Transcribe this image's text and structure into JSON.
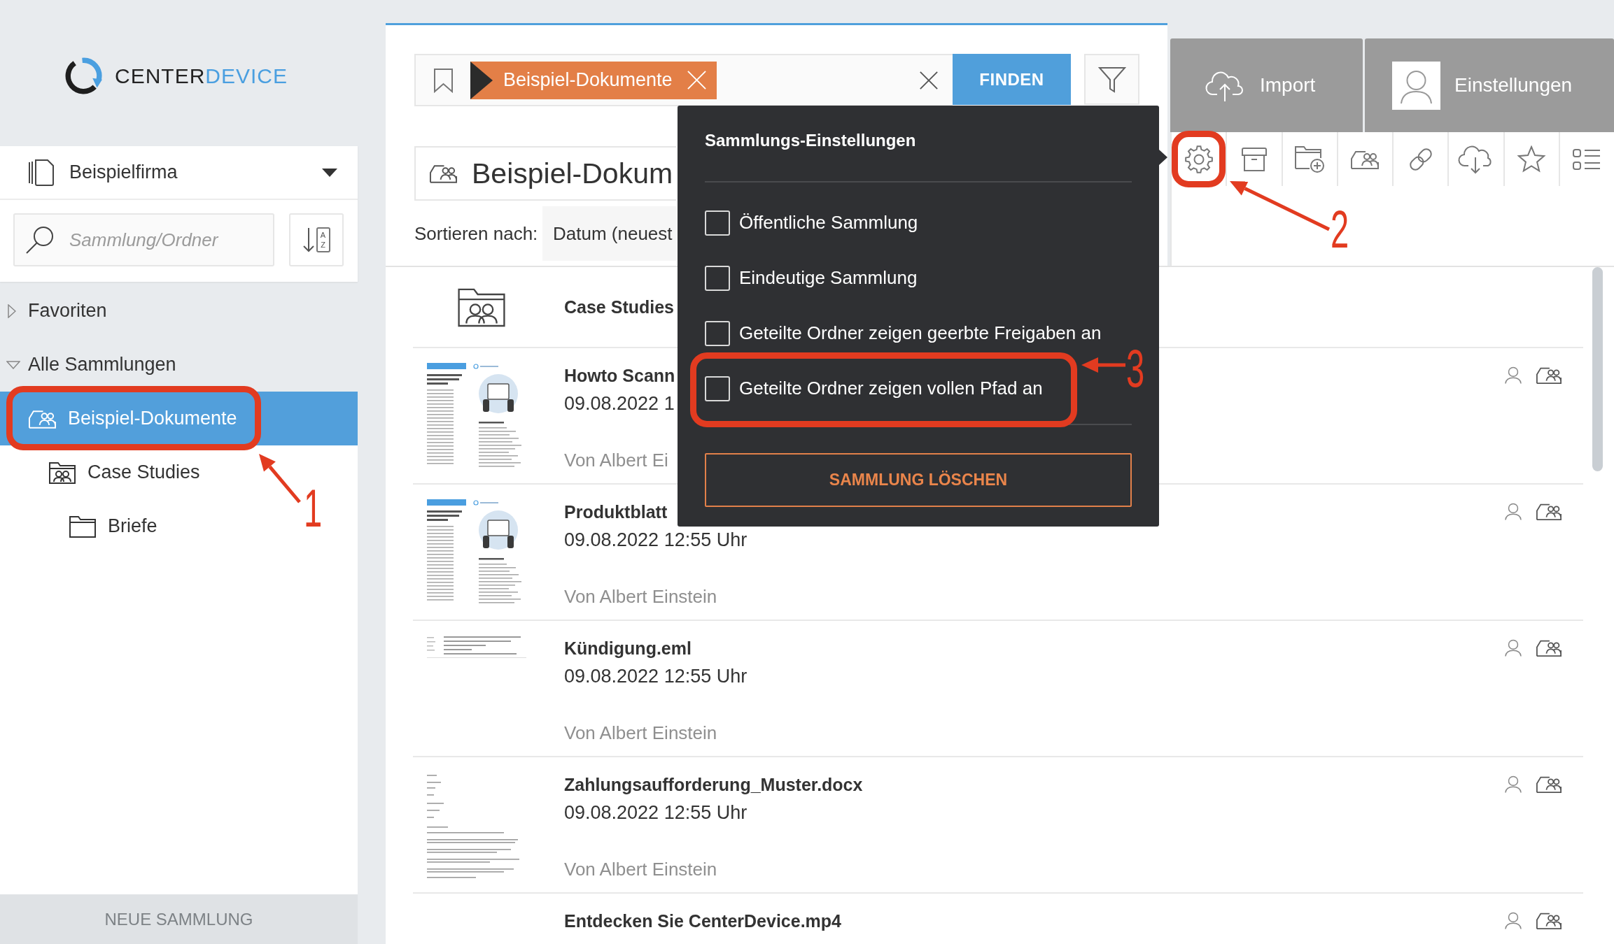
{
  "logo": {
    "part_1": "CENTER",
    "part_2": "DEVICE"
  },
  "sidebar": {
    "company": "Beispielfirma",
    "search": {
      "placeholder": "Sammlung/Ordner"
    },
    "sort_letters": [
      "A",
      "Z"
    ],
    "sections": [
      {
        "label": "Favoriten",
        "expanded": false,
        "selected": false
      },
      {
        "label": "Alle Sammlungen",
        "expanded": true,
        "selected": false,
        "children": [
          {
            "label": "Beispiel-Dokumente",
            "kind": "collection",
            "selected": true,
            "children": [
              {
                "label": "Case Studies",
                "kind": "shared-folder",
                "selected": false,
                "children": [
                  {
                    "label": "Briefe",
                    "kind": "folder",
                    "selected": false
                  }
                ]
              }
            ]
          }
        ]
      }
    ],
    "new_collection_button": "NEUE SAMMLUNG"
  },
  "search": {
    "tag": "Beispiel-Dokumente",
    "button": "FINDEN"
  },
  "collection": {
    "title": "Beispiel-Dokum",
    "sort_label": "Sortieren nach:",
    "sort_value": "Datum (neuest"
  },
  "header_buttons": [
    {
      "kind": "import",
      "label": "Import"
    },
    {
      "kind": "account",
      "label": "Einstellungen"
    }
  ],
  "documents": [
    {
      "kind": "folder",
      "title": "Case Studies"
    },
    {
      "kind": "brochure",
      "title": "Howto Scann",
      "date": "09.08.2022 1",
      "author": "Von Albert Ei"
    },
    {
      "kind": "brochure",
      "title": "Produktblatt",
      "date": "09.08.2022 12:55 Uhr",
      "author": "Von Albert Einstein"
    },
    {
      "kind": "email",
      "title": "Kündigung.eml",
      "date": "09.08.2022 12:55 Uhr",
      "author": "Von Albert Einstein"
    },
    {
      "kind": "letter",
      "title": "Zahlungsaufforderung_Muster.docx",
      "date": "09.08.2022 12:55 Uhr",
      "author": "Von Albert Einstein"
    },
    {
      "kind": "document",
      "title": "Entdecken Sie CenterDevice.mp4"
    }
  ],
  "settings_popup": {
    "title": "Sammlungs-Einstellungen",
    "options": [
      {
        "label": "Öffentliche Sammlung",
        "checked": false
      },
      {
        "label": "Eindeutige Sammlung",
        "checked": false
      },
      {
        "label": "Geteilte Ordner zeigen geerbte Freigaben an",
        "checked": false
      },
      {
        "label": "Geteilte Ordner zeigen vollen Pfad an",
        "checked": false
      }
    ],
    "delete_button": "SAMMLUNG LÖSCHEN"
  },
  "annotations": [
    {
      "number": "1"
    },
    {
      "number": "2"
    },
    {
      "number": "3"
    }
  ]
}
